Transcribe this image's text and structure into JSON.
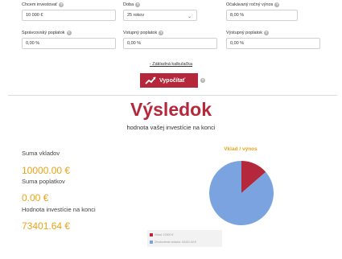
{
  "form": {
    "initial_investment": {
      "label": "Chcem investovať",
      "value": "10 000 €"
    },
    "duration": {
      "label": "Doba",
      "value": "25 rokov"
    },
    "expected_return": {
      "label": "Očakávaný ročný výnos",
      "value": "8,00 %"
    },
    "management_fee": {
      "label": "Správcovský poplatok",
      "value": "0,00 %"
    },
    "entry_fee": {
      "label": "Vstupný poplatok",
      "value": "0,00 %"
    },
    "exit_fee": {
      "label": "Výstupný poplatok",
      "value": "0,00 %"
    }
  },
  "basic_calculator_link": "- Základná kalkulačka",
  "calculate_button": "Vypočítať",
  "result": {
    "title": "Výsledok",
    "subtitle": "hodnota vašej investície na konci"
  },
  "stats": {
    "deposits_label": "Suma vkladov",
    "deposits_value": "10000.00 €",
    "fees_label": "Suma poplatkov",
    "fees_value": "0.00 €",
    "final_label": "Hodnota investície na konci",
    "final_value": "73401.64 €"
  },
  "colors": {
    "brand_red": "#b5283c",
    "accent_gold": "#e8a317",
    "pie_blue": "#7aa3e0"
  },
  "chart_data": {
    "type": "pie",
    "title": "Vklad / výnos",
    "series": [
      {
        "name": "Vklad: 10000 €",
        "value": 10000,
        "color": "#b5283c"
      },
      {
        "name": "Zhodnotenie vkladov: 63401.64 €",
        "value": 63401.64,
        "color": "#7aa3e0"
      }
    ]
  }
}
